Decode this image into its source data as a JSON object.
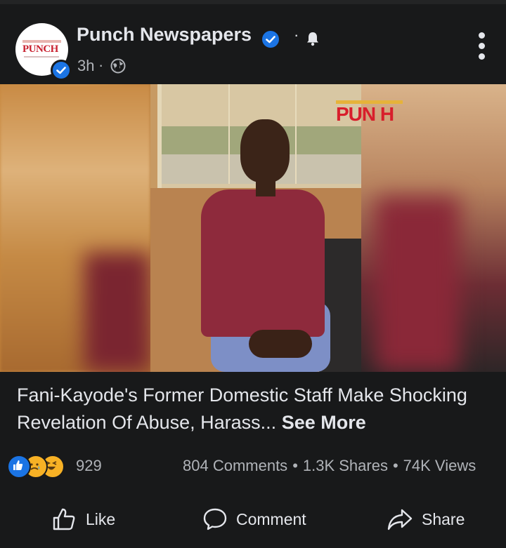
{
  "post": {
    "page_name": "Punch Newspapers",
    "avatar_logo_text": "PUNCH",
    "time": "3h",
    "time_separator": "·",
    "notify_separator": "·"
  },
  "media": {
    "watermark": "PUN H"
  },
  "caption": {
    "text": "Fani-Kayode's Former Domestic Staff Make Shocking Revelation Of Abuse, Harass...",
    "see_more": "See More"
  },
  "engagement": {
    "reaction_icons": [
      "like-icon",
      "sad-icon",
      "haha-icon"
    ],
    "reaction_count": "929",
    "comments": "804 Comments",
    "shares": "1.3K Shares",
    "views": "74K Views",
    "separator": "•"
  },
  "actions": {
    "like": "Like",
    "comment": "Comment",
    "share": "Share"
  },
  "colors": {
    "background": "#18191a",
    "text_primary": "#e4e6eb",
    "text_secondary": "#b0b3b8",
    "accent_blue": "#1b74e4",
    "brand_red": "#d81e2b"
  }
}
